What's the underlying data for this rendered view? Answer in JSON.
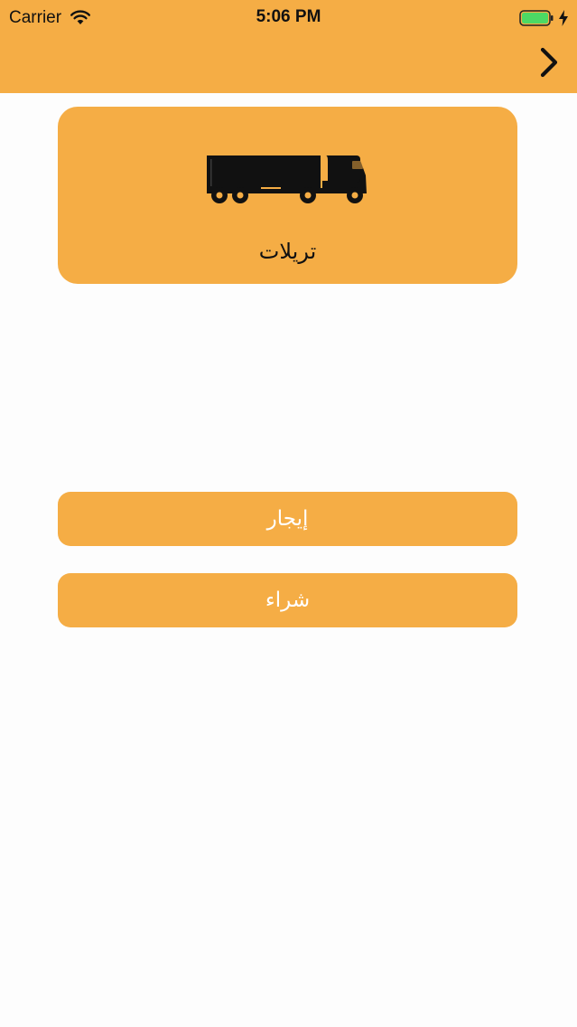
{
  "status_bar": {
    "carrier": "Carrier",
    "time": "5:06 PM"
  },
  "icons": {
    "wifi": "wifi-icon",
    "battery": "battery-icon",
    "charging": "charging-icon",
    "forward": "chevron-right-icon",
    "truck": "semi-truck-icon"
  },
  "category": {
    "label": "تريلات"
  },
  "actions": {
    "rent_label": "إيجار",
    "buy_label": "شراء"
  },
  "colors": {
    "accent": "#f5ad45",
    "background": "#fdfdfd",
    "battery_green": "#4cd964"
  }
}
